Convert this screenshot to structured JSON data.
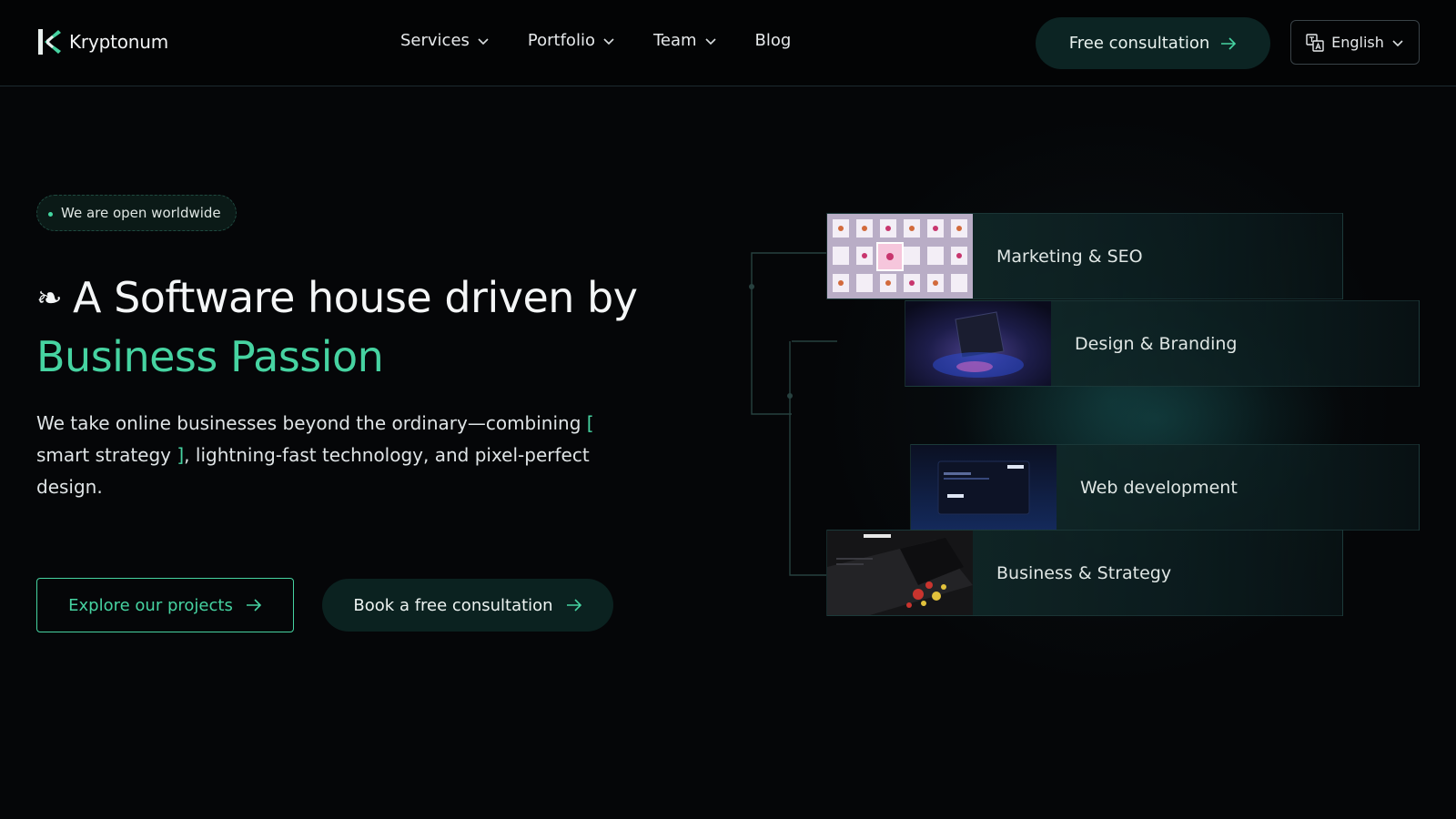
{
  "header": {
    "brand": "Kryptonum",
    "nav": [
      {
        "label": "Services",
        "dropdown": true
      },
      {
        "label": "Portfolio",
        "dropdown": true
      },
      {
        "label": "Team",
        "dropdown": true
      },
      {
        "label": "Blog",
        "dropdown": false
      }
    ],
    "cta_label": "Free consultation",
    "language": "English"
  },
  "hero": {
    "badge": "We are open worldwide",
    "headline_line1": "A Software house driven by",
    "headline_accent": "Business Passion",
    "desc_part1": "We take online businesses beyond the ordinary—combining",
    "desc_bracket_open": "[",
    "desc_highlight": " smart strategy ",
    "desc_bracket_close": "]",
    "desc_part2": ", lightning-fast technology, and pixel-perfect design.",
    "primary_button": "Explore our projects",
    "secondary_button": "Book a free consultation"
  },
  "services": [
    {
      "label": "Marketing & SEO",
      "thumb": "marketing-thumbnail"
    },
    {
      "label": "Design & Branding",
      "thumb": "design-thumbnail"
    },
    {
      "label": "Web development",
      "thumb": "webdev-thumbnail"
    },
    {
      "label": "Business & Strategy",
      "thumb": "strategy-thumbnail"
    }
  ],
  "colors": {
    "accent": "#46d3a1",
    "background": "#050608",
    "button_dark": "#0b2220"
  }
}
